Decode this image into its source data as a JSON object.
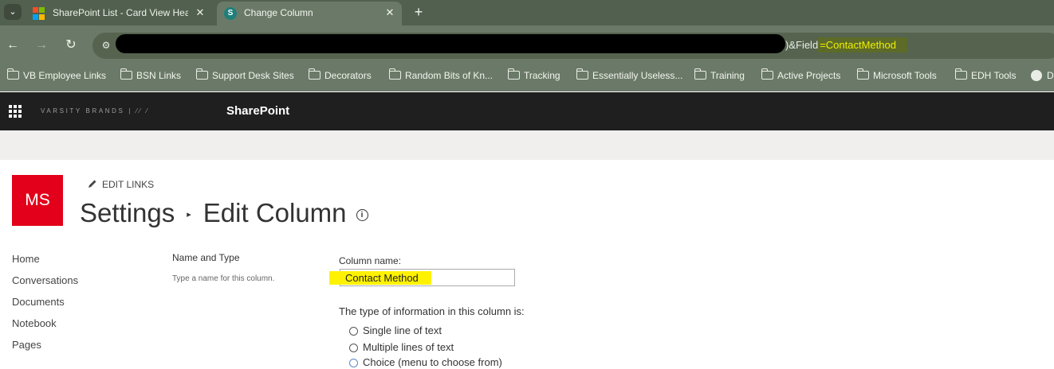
{
  "browser": {
    "tabs": [
      {
        "title": "SharePoint List - Card View Hea",
        "active": false,
        "favicon": "microsoft-logo-icon"
      },
      {
        "title": "Change Column",
        "active": true,
        "favicon": "sharepoint-icon"
      }
    ],
    "close_glyph": "✕",
    "new_tab_glyph": "+",
    "menu_glyph": "⌄",
    "back_glyph": "←",
    "forward_glyph": "→",
    "reload_glyph": "↻",
    "tune_glyph": "⚙",
    "address": {
      "visible_suffix": ")&Field",
      "highlighted": "=ContactMethod",
      "highlight_color": "#f0f000"
    },
    "bookmarks": [
      {
        "label": "VB Employee Links",
        "icon": "folder-icon"
      },
      {
        "label": "BSN Links",
        "icon": "folder-icon"
      },
      {
        "label": "Support Desk Sites",
        "icon": "folder-icon"
      },
      {
        "label": "Decorators",
        "icon": "folder-icon"
      },
      {
        "label": "Random Bits of Kn...",
        "icon": "folder-icon"
      },
      {
        "label": "Tracking",
        "icon": "folder-icon"
      },
      {
        "label": "Essentially Useless...",
        "icon": "folder-icon"
      },
      {
        "label": "Training",
        "icon": "folder-icon"
      },
      {
        "label": "Active Projects",
        "icon": "folder-icon"
      },
      {
        "label": "Microsoft Tools",
        "icon": "folder-icon"
      },
      {
        "label": "EDH Tools",
        "icon": "folder-icon"
      },
      {
        "label": "D",
        "icon": "globe-icon"
      }
    ]
  },
  "suite": {
    "brand_text": "VARSITY BRANDS",
    "brand_suffix": "| ⁄⁄ ⁄",
    "title": "SharePoint"
  },
  "site": {
    "logo_text": "MS",
    "logo_color": "#e3001b",
    "edit_links": "EDIT LINKS",
    "breadcrumb": [
      "Settings",
      "Edit Column"
    ],
    "breadcrumb_sep": "▸",
    "info_glyph": "i"
  },
  "quick_launch": [
    "Home",
    "Conversations",
    "Documents",
    "Notebook",
    "Pages"
  ],
  "form": {
    "section_title": "Name and Type",
    "section_desc": "Type a name for this column.",
    "column_name_label": "Column name:",
    "column_name_value": "Contact Method",
    "type_label": "The type of information in this column is:",
    "types": [
      "Single line of text",
      "Multiple lines of text",
      "Choice (menu to choose from)"
    ],
    "highlight_color": "#fff200"
  }
}
